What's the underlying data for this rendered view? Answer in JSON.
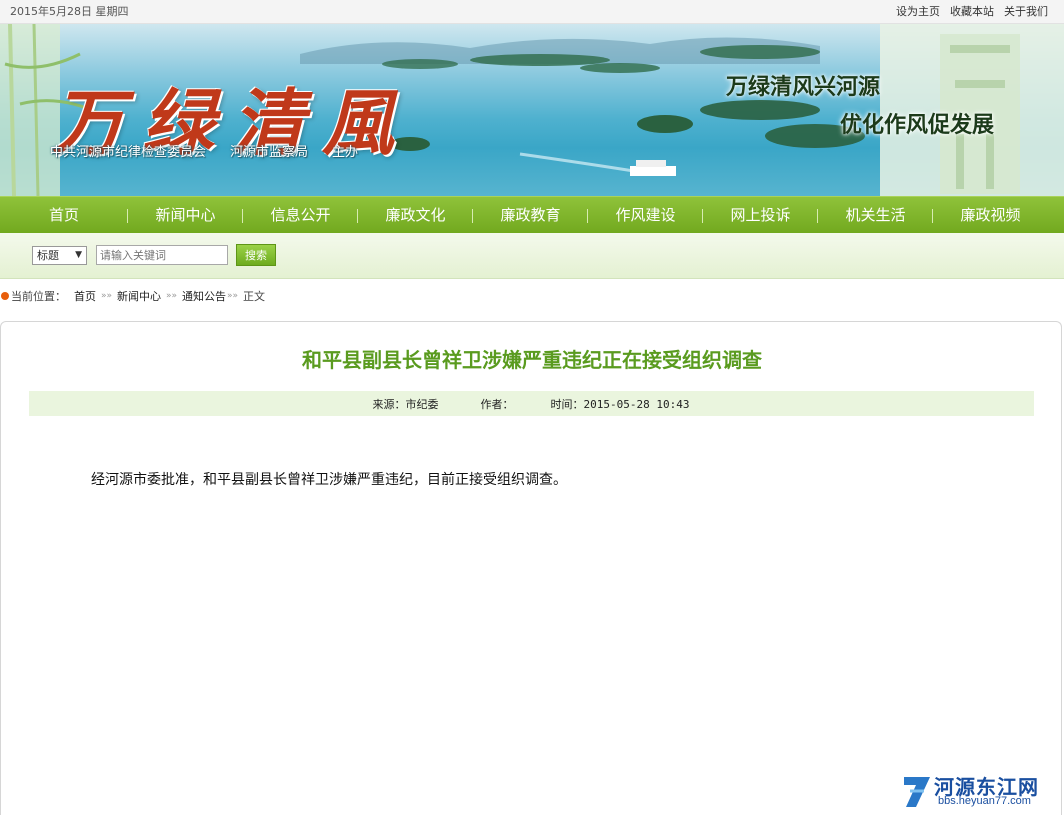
{
  "topbar": {
    "date": "2015年5月28日  星期四",
    "links": [
      "设为主页",
      "收藏本站",
      "关于我们"
    ]
  },
  "banner": {
    "logo_text": "万绿清風",
    "sponsors": [
      "中共河源市纪律检查委员会",
      "河源市监察局",
      "主办"
    ],
    "slogan_line1": "万绿清风兴河源",
    "slogan_line2": "优化作风促发展"
  },
  "nav": {
    "items": [
      "首页",
      "新闻中心",
      "信息公开",
      "廉政文化",
      "廉政教育",
      "作风建设",
      "网上投诉",
      "机关生活",
      "廉政视频"
    ]
  },
  "search": {
    "field_select": "标题",
    "placeholder": "请输入关键词",
    "button_label": "搜索"
  },
  "breadcrumb": {
    "prefix": "当前位置：",
    "items": [
      "首页",
      "新闻中心",
      "通知公告",
      "正文"
    ]
  },
  "article": {
    "title": "和平县副县长曾祥卫涉嫌严重违纪正在接受组织调查",
    "source": "来源：市纪委",
    "author": "作者：",
    "time": "时间：2015-05-28 10:43",
    "body": "经河源市委批准，和平县副县长曾祥卫涉嫌严重违纪，目前正接受组织调查。"
  },
  "watermark": {
    "name": "河源东江网",
    "url": "bbs.heyuan77.com"
  },
  "colors": {
    "nav_green": "#7db32a",
    "title_green": "#5a9b1f",
    "meta_bg": "#eaf5de",
    "logo_red": "#c0391a"
  }
}
